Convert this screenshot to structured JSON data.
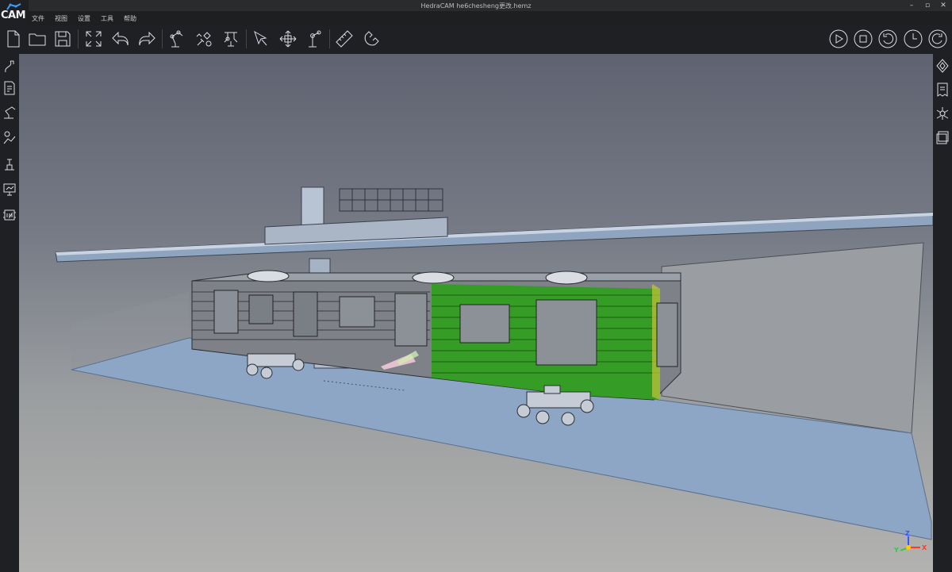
{
  "app": {
    "logo_text": "CAM",
    "window_title": "HedraCAM  he6chesheng更改.hemz"
  },
  "menu": [
    "文件",
    "视图",
    "设置",
    "工具",
    "帮助"
  ],
  "window_controls": [
    "–",
    "▫",
    "✕"
  ],
  "toolbar_left": [
    {
      "name": "new-file-icon"
    },
    {
      "name": "open-folder-icon"
    },
    {
      "name": "save-icon"
    },
    {
      "name": "fit-view-icon"
    },
    {
      "name": "undo-icon"
    },
    {
      "name": "redo-icon"
    },
    {
      "name": "robot-arm-icon"
    },
    {
      "name": "robot-tool-icon"
    },
    {
      "name": "gantry-robot-icon"
    },
    {
      "name": "select-cursor-icon"
    },
    {
      "name": "move-icon"
    },
    {
      "name": "robot-joint-icon"
    },
    {
      "name": "ruler-icon"
    },
    {
      "name": "magnet-icon"
    }
  ],
  "toolbar_right": [
    {
      "name": "play-icon"
    },
    {
      "name": "stop-icon"
    },
    {
      "name": "rotate-ccw-icon"
    },
    {
      "name": "clock-icon"
    },
    {
      "name": "rotate-cw-icon"
    }
  ],
  "left_sidebar": [
    {
      "name": "path-icon"
    },
    {
      "name": "program-edit-icon"
    },
    {
      "name": "robot-arm-side-icon"
    },
    {
      "name": "workpiece-icon"
    },
    {
      "name": "fixture-icon"
    },
    {
      "name": "monitor-robot-icon"
    },
    {
      "name": "io-signal-icon"
    }
  ],
  "right_sidebar": [
    {
      "name": "diamond-nav-icon"
    },
    {
      "name": "document-icon"
    },
    {
      "name": "network-icon"
    },
    {
      "name": "layers-icon"
    }
  ],
  "axis_labels": {
    "z": "Z",
    "x": "X",
    "y": "Y"
  },
  "colors": {
    "paint_green": "#2e9e1b",
    "floor_blue": "#8ea6c6",
    "ui_dark": "#1f2023"
  }
}
